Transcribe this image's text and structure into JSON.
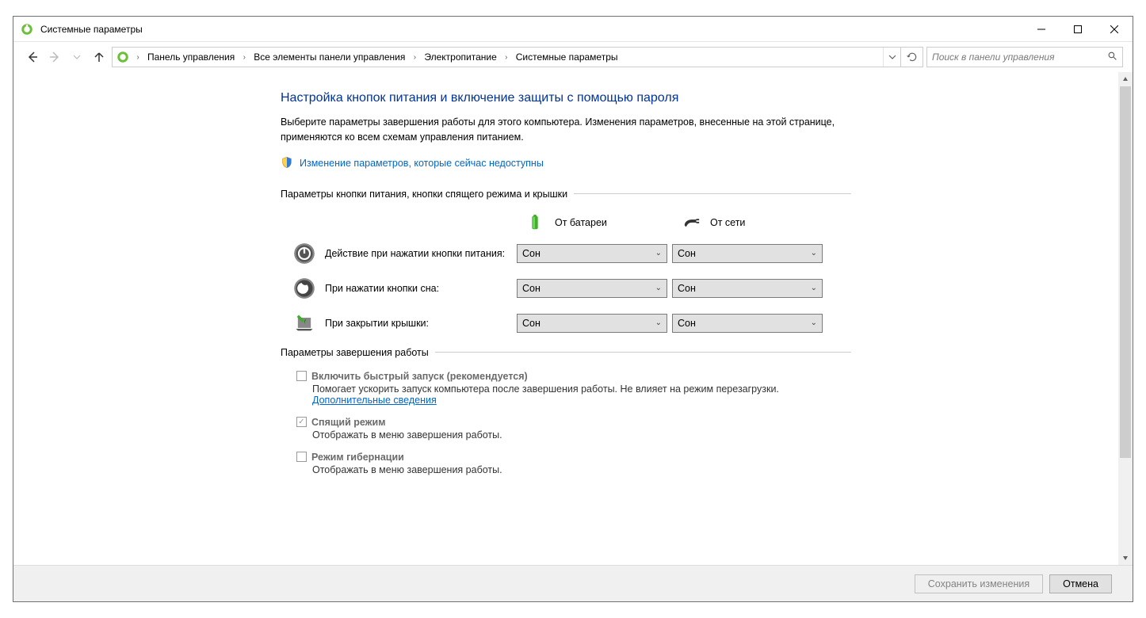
{
  "window": {
    "title": "Системные параметры"
  },
  "breadcrumb": {
    "items": [
      "Панель управления",
      "Все элементы панели управления",
      "Электропитание",
      "Системные параметры"
    ]
  },
  "search": {
    "placeholder": "Поиск в панели управления"
  },
  "heading": "Настройка кнопок питания и включение защиты с помощью пароля",
  "intro": "Выберите параметры завершения работы для этого компьютера. Изменения параметров, внесенные на этой странице, применяются ко всем схемам управления питанием.",
  "shield_link": "Изменение параметров, которые сейчас недоступны",
  "section1_title": "Параметры кнопки питания, кнопки спящего режима и крышки",
  "col_headers": {
    "battery": "От батареи",
    "plugged": "От сети"
  },
  "rows": {
    "power": {
      "label": "Действие при нажатии кнопки питания:",
      "battery": "Сон",
      "plugged": "Сон"
    },
    "sleep": {
      "label": "При нажатии кнопки сна:",
      "battery": "Сон",
      "plugged": "Сон"
    },
    "lid": {
      "label": "При закрытии крышки:",
      "battery": "Сон",
      "plugged": "Сон"
    }
  },
  "section2_title": "Параметры завершения работы",
  "shutdown": {
    "fast": {
      "title": "Включить быстрый запуск (рекомендуется)",
      "desc_pre": "Помогает ускорить запуск компьютера после завершения работы. Не влияет на режим перезагрузки. ",
      "link": "Дополнительные сведения"
    },
    "sleep": {
      "title": "Спящий режим",
      "desc": "Отображать в меню завершения работы."
    },
    "hibernate": {
      "title": "Режим гибернации",
      "desc": "Отображать в меню завершения работы."
    }
  },
  "footer": {
    "save": "Сохранить изменения",
    "cancel": "Отмена"
  }
}
